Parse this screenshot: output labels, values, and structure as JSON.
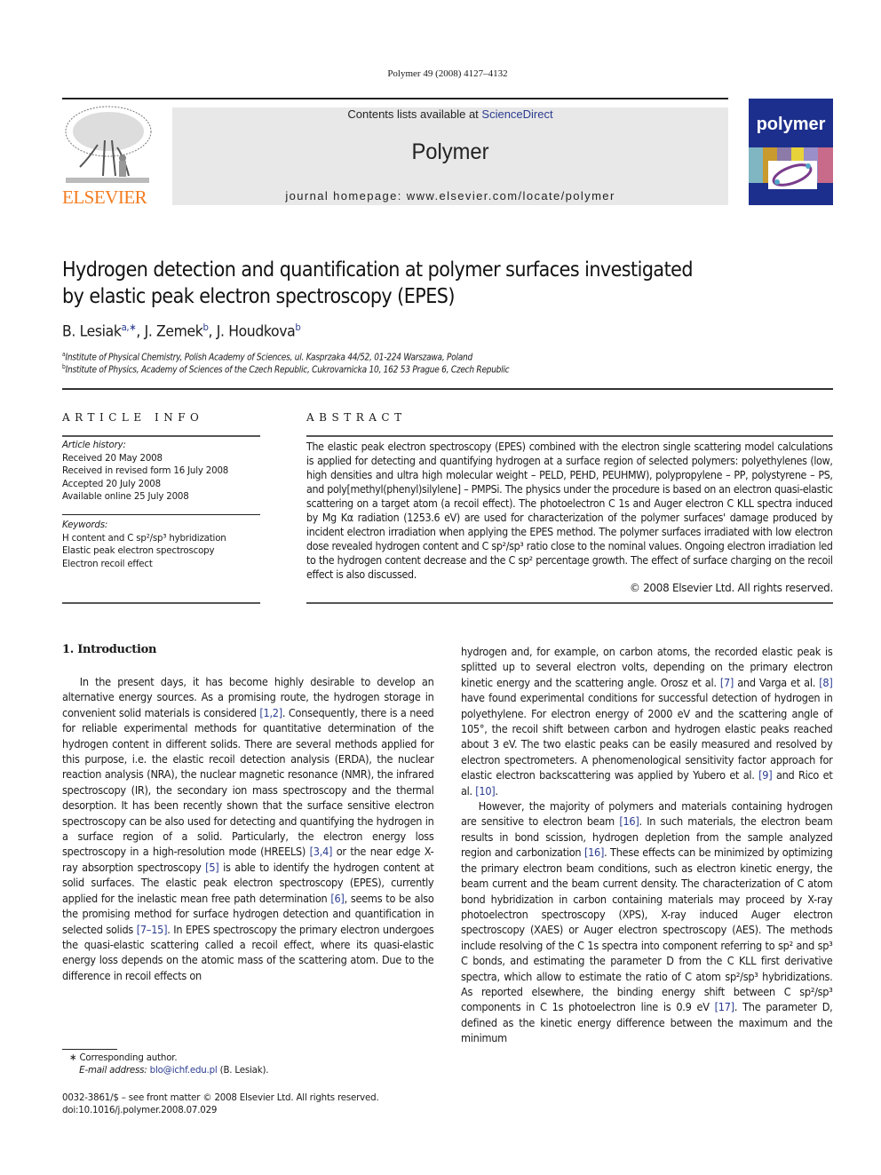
{
  "citation": "Polymer 49 (2008) 4127–4132",
  "masthead": {
    "contents_prefix": "Contents lists available at ",
    "contents_link": "ScienceDirect",
    "journal_name": "Polymer",
    "homepage": "journal homepage: www.elsevier.com/locate/polymer",
    "publisher_logo_text": "ELSEVIER",
    "cover_title": "polymer",
    "colors": {
      "banner_bg": "#e8e8e8",
      "publisher_orange": "#f47c20",
      "cover_blue": "#1d2f8c",
      "link_blue": "#2a3b8f"
    }
  },
  "article": {
    "title_line1": "Hydrogen detection and quantification at polymer surfaces investigated",
    "title_line2": "by elastic peak electron spectroscopy (EPES)",
    "authors": [
      {
        "name": "B. Lesiak",
        "marks": "a,∗"
      },
      {
        "name": "J. Zemek",
        "marks": "b"
      },
      {
        "name": "J. Houdkova",
        "marks": "b"
      }
    ],
    "affiliations": [
      {
        "mark": "a",
        "text": "Institute of Physical Chemistry, Polish Academy of Sciences, ul. Kasprzaka 44/52, 01-224 Warszawa, Poland"
      },
      {
        "mark": "b",
        "text": "Institute of Physics, Academy of Sciences of the Czech Republic, Cukrovarnicka 10, 162 53 Prague 6, Czech Republic"
      }
    ]
  },
  "article_info": {
    "heading": "ARTICLE INFO",
    "history_label": "Article history:",
    "history": [
      "Received 20 May 2008",
      "Received in revised form 16 July 2008",
      "Accepted 20 July 2008",
      "Available online 25 July 2008"
    ],
    "keywords_label": "Keywords:",
    "keywords": [
      "H content and C sp²/sp³ hybridization",
      "Elastic peak electron spectroscopy",
      "Electron recoil effect"
    ]
  },
  "abstract": {
    "heading": "ABSTRACT",
    "text": "The elastic peak electron spectroscopy (EPES) combined with the electron single scattering model calculations is applied for detecting and quantifying hydrogen at a surface region of selected polymers: polyethylenes (low, high densities and ultra high molecular weight – PELD, PEHD, PEUHMW), polypropylene – PP, polystyrene – PS, and poly[methyl(phenyl)silylene] – PMPSi. The physics under the procedure is based on an electron quasi-elastic scattering on a target atom (a recoil effect). The photoelectron C 1s and Auger electron C KLL spectra induced by Mg Kα radiation (1253.6 eV) are used for characterization of the polymer surfaces' damage produced by incident electron irradiation when applying the EPES method. The polymer surfaces irradiated with low electron dose revealed hydrogen content and C sp²/sp³ ratio close to the nominal values. Ongoing electron irradiation led to the hydrogen content decrease and the C sp² percentage growth. The effect of surface charging on the recoil effect is also discussed.",
    "copyright": "© 2008 Elsevier Ltd. All rights reserved."
  },
  "body": {
    "section_heading": "1.  Introduction",
    "left_paragraph": [
      "In the present days, it has become highly desirable to develop an alternative energy sources. As a promising route, the hydrogen storage in convenient solid materials is considered ",
      "[1,2]",
      ". Consequently, there is a need for reliable experimental methods for quantitative determination of the hydrogen content in different solids. There are several methods applied for this purpose, i.e. the elastic recoil detection analysis (ERDA), the nuclear reaction analysis (NRA), the nuclear magnetic resonance (NMR), the infrared spectroscopy (IR), the secondary ion mass spectroscopy and the thermal desorption. It has been recently shown that the surface sensitive electron spectroscopy can be also used for detecting and quantifying the hydrogen in a surface region of a solid. Particularly, the electron energy loss spectroscopy in a high-resolution mode (HREELS) ",
      "[3,4]",
      " or the near edge X-ray absorption spectroscopy ",
      "[5]",
      " is able to identify the hydrogen content at solid surfaces. The elastic peak electron spectroscopy (EPES), currently applied for the inelastic mean free path determination ",
      "[6]",
      ", seems to be also the promising method for surface hydrogen detection and quantification in selected solids ",
      "[7–15]",
      ". In EPES spectroscopy the primary electron undergoes the quasi-elastic scattering called a recoil effect, where its quasi-elastic energy loss depends on the atomic mass of the scattering atom. Due to the difference in recoil effects on"
    ],
    "right_paragraph_1": [
      "hydrogen and, for example, on carbon atoms, the recorded elastic peak is splitted up to several electron volts, depending on the primary electron kinetic energy and the scattering angle. Orosz et al. ",
      "[7]",
      " and Varga et al. ",
      "[8]",
      " have found experimental conditions for successful detection of hydrogen in polyethylene. For electron energy of 2000 eV and the scattering angle of 105°, the recoil shift between carbon and hydrogen elastic peaks reached about 3 eV. The two elastic peaks can be easily measured and resolved by electron spectrometers. A phenomenological sensitivity factor approach for elastic electron backscattering was applied by Yubero et al. ",
      "[9]",
      " and Rico et al. ",
      "[10]",
      "."
    ],
    "right_paragraph_2": [
      "However, the majority of polymers and materials containing hydrogen are sensitive to electron beam ",
      "[16]",
      ". In such materials, the electron beam results in bond scission, hydrogen depletion from the sample analyzed region and carbonization ",
      "[16]",
      ". These effects can be minimized by optimizing the primary electron beam conditions, such as electron kinetic energy, the beam current and the beam current density. The characterization of C atom bond hybridization in carbon containing materials may proceed by X-ray photoelectron spectroscopy (XPS), X-ray induced Auger electron spectroscopy (XAES) or Auger electron spectroscopy (AES). The methods include resolving of the C 1s spectra into component referring to sp² and sp³ C bonds, and estimating the parameter D from the C KLL first derivative spectra, which allow to estimate the ratio of C atom sp²/sp³ hybridizations. As reported elsewhere, the binding energy shift between C sp²/sp³ components in C 1s photoelectron line is 0.9 eV ",
      "[17]",
      ". The parameter D, defined as the kinetic energy difference between the maximum and the minimum"
    ]
  },
  "footnotes": {
    "corresponding_mark": "∗",
    "corresponding": "Corresponding author.",
    "email_label": "E-mail address:",
    "email": "blo@ichf.edu.pl",
    "email_suffix": " (B. Lesiak)."
  },
  "front_matter": {
    "issn_line": "0032-3861/$ – see front matter © 2008 Elsevier Ltd. All rights reserved.",
    "doi": "doi:10.1016/j.polymer.2008.07.029"
  }
}
